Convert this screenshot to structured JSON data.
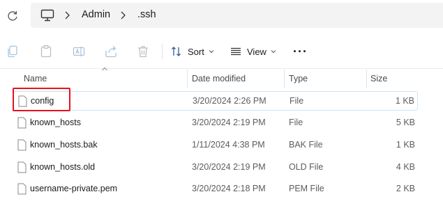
{
  "address": {
    "crumbs": [
      "Admin",
      ".ssh"
    ]
  },
  "toolbar": {
    "sort_label": "Sort",
    "view_label": "View",
    "more_label": "···"
  },
  "columns": {
    "name": "Name",
    "date": "Date modified",
    "type": "Type",
    "size": "Size"
  },
  "files": [
    {
      "name": "config",
      "date": "3/20/2024 2:26 PM",
      "type": "File",
      "size": "1 KB"
    },
    {
      "name": "known_hosts",
      "date": "3/20/2024 2:19 PM",
      "type": "File",
      "size": "5 KB"
    },
    {
      "name": "known_hosts.bak",
      "date": "1/11/2024 4:38 PM",
      "type": "BAK File",
      "size": "1 KB"
    },
    {
      "name": "known_hosts.old",
      "date": "3/20/2024 2:19 PM",
      "type": "OLD File",
      "size": "4 KB"
    },
    {
      "name": "username-private.pem",
      "date": "3/20/2024 2:18 PM",
      "type": "PEM File",
      "size": "2 KB"
    }
  ],
  "colors": {
    "highlight": "#e8101c",
    "selection_border": "#d0e3f5"
  }
}
